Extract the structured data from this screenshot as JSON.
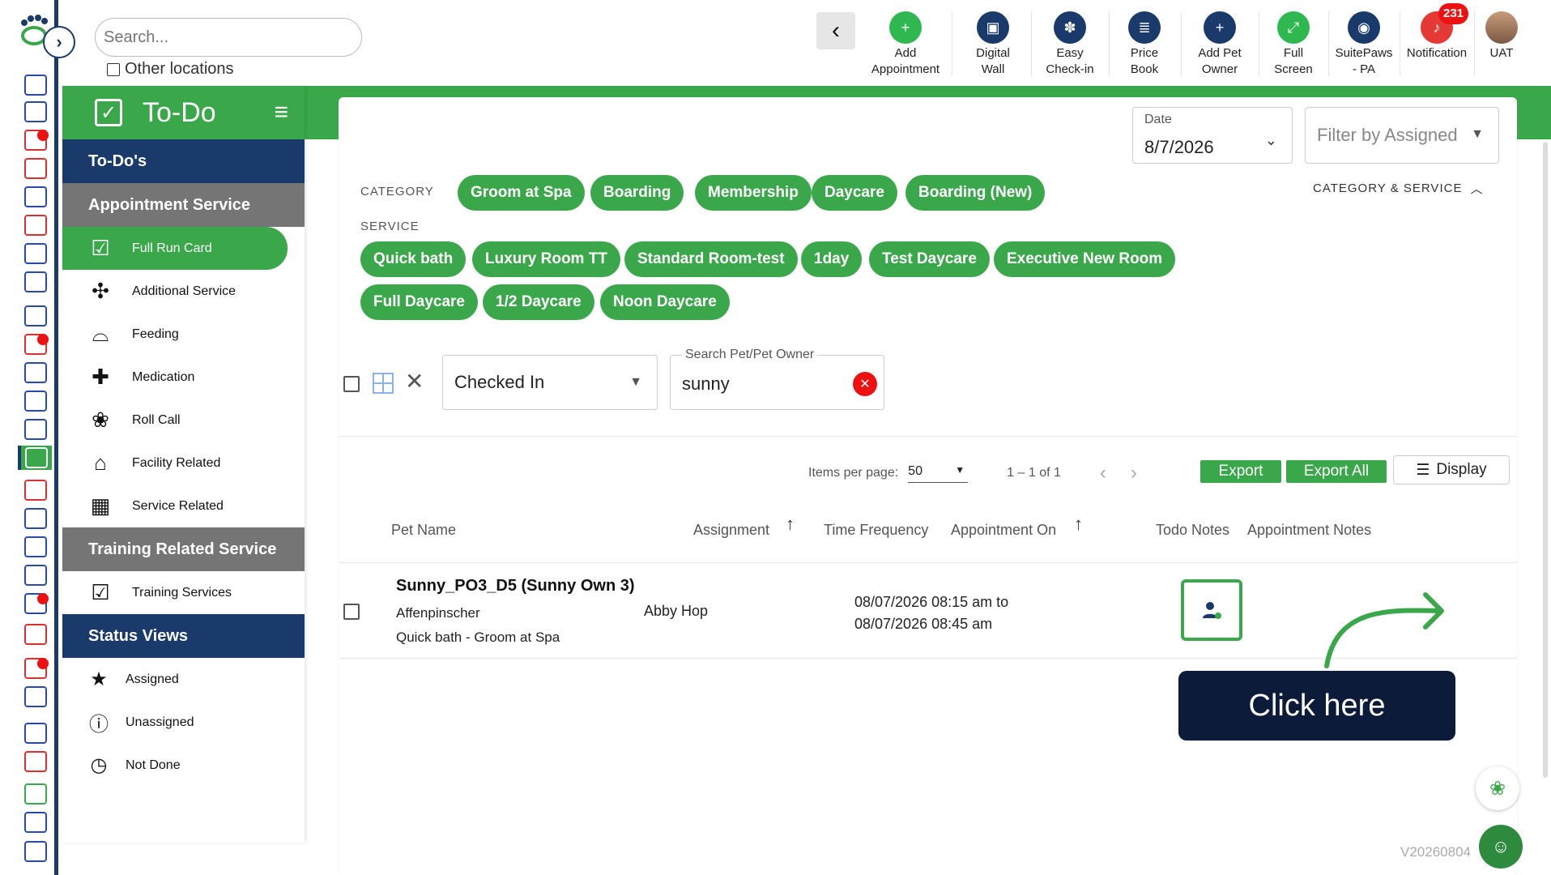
{
  "search": {
    "placeholder": "Search..."
  },
  "other_locations": "Other locations",
  "toolbar": [
    {
      "icon": "add-appointment-icon",
      "label1": "Add",
      "label2": "Appointment"
    },
    {
      "icon": "digital-wall-icon",
      "label1": "Digital",
      "label2": "Wall"
    },
    {
      "icon": "easy-checkin-icon",
      "label1": "Easy",
      "label2": "Check-in"
    },
    {
      "icon": "price-book-icon",
      "label1": "Price",
      "label2": "Book"
    },
    {
      "icon": "add-pet-owner-icon",
      "label1": "Add Pet",
      "label2": "Owner"
    },
    {
      "icon": "full-screen-icon",
      "label1": "Full",
      "label2": "Screen"
    },
    {
      "icon": "suitepaws-icon",
      "label1": "SuitePaws",
      "label2": "- PA"
    },
    {
      "icon": "notification-icon",
      "label1": "Notification",
      "label2": "",
      "badge": "231"
    },
    {
      "icon": "avatar",
      "label1": "UAT",
      "label2": ""
    }
  ],
  "sidemenu": {
    "title": "To-Do",
    "sec_todos": "To-Do's",
    "sec_appt": "Appointment Service",
    "appt_items": [
      "Full Run Card",
      "Additional Service",
      "Feeding",
      "Medication",
      "Roll Call",
      "Facility Related",
      "Service Related"
    ],
    "sec_training": "Training Related Service",
    "training_items": [
      "Training Services"
    ],
    "sec_status": "Status Views",
    "status_items": [
      "Assigned",
      "Unassigned",
      "Not Done"
    ]
  },
  "filters": {
    "date_label": "Date",
    "date_value": "8/7/2026",
    "filter_assigned_placeholder": "Filter by Assigned",
    "category_label": "CATEGORY",
    "service_label": "SERVICE",
    "cat_svc_toggle": "CATEGORY & SERVICE",
    "categories": [
      "Groom at Spa",
      "Boarding",
      "Membership",
      "Daycare",
      "Boarding (New)"
    ],
    "services_row1": [
      "Quick bath",
      "Luxury Room TT",
      "Standard Room-test",
      "1day",
      "Test Daycare",
      "Executive New Room"
    ],
    "services_row2": [
      "Full Daycare",
      "1/2 Daycare",
      "Noon Daycare"
    ],
    "status_value": "Checked In",
    "search_pet_label": "Search Pet/Pet Owner",
    "search_pet_value": "sunny"
  },
  "pager": {
    "items_per_page_label": "Items per page:",
    "items_per_page": "50",
    "range": "1 – 1 of 1",
    "export": "Export",
    "export_all": "Export All",
    "display": "Display"
  },
  "table": {
    "headers": [
      "Pet Name",
      "Assignment",
      "Time Frequency",
      "Appointment On",
      "Todo Notes",
      "Appointment Notes"
    ],
    "row": {
      "pet_name": "Sunny_PO3_D5 (Sunny Own 3)",
      "breed": "Affenpinscher",
      "service": "Quick bath - Groom at Spa",
      "assignee": "Abby Hop",
      "appt_from": "08/07/2026 08:15 am to",
      "appt_to": "08/07/2026 08:45 am"
    }
  },
  "callout": "Click here",
  "version": "V20260804",
  "colors": {
    "brand_green": "#3aa84a",
    "navy": "#1a3a6b",
    "alert_red": "#e11111"
  }
}
